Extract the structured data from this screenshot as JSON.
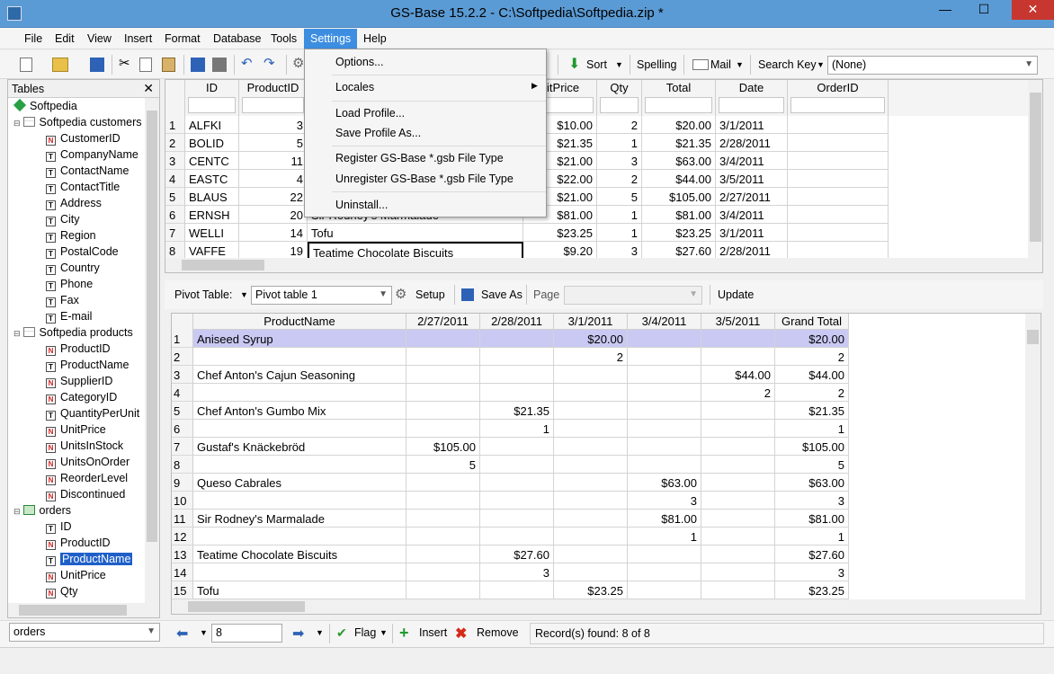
{
  "window": {
    "title": "GS-Base 15.2.2 - C:\\Softpedia\\Softpedia.zip *",
    "minimize": "—",
    "maximize": "☐",
    "close": "✕"
  },
  "menubar": [
    "File",
    "Edit",
    "View",
    "Insert",
    "Format",
    "Database",
    "Tools",
    "Settings",
    "Help"
  ],
  "toolbar": {
    "sort": "Sort",
    "spelling": "Spelling",
    "mail": "Mail",
    "search_key": "Search Key",
    "search_value": "(None)"
  },
  "settings_menu": {
    "options": "Options...",
    "locales": "Locales",
    "load_profile": "Load Profile...",
    "save_profile": "Save Profile As...",
    "register": "Register GS-Base *.gsb File Type",
    "unregister": "Unregister GS-Base *.gsb File Type",
    "uninstall": "Uninstall..."
  },
  "tables_panel": {
    "title": "Tables",
    "root": "Softpedia",
    "customers_table": "Softpedia customers",
    "customers_fields": [
      "CustomerID",
      "CompanyName",
      "ContactName",
      "ContactTitle",
      "Address",
      "City",
      "Region",
      "PostalCode",
      "Country",
      "Phone",
      "Fax",
      "E-mail"
    ],
    "products_table": "Softpedia products",
    "products_fields": [
      "ProductID",
      "ProductName",
      "SupplierID",
      "CategoryID",
      "QuantityPerUnit",
      "UnitPrice",
      "UnitsInStock",
      "UnitsOnOrder",
      "ReorderLevel",
      "Discontinued"
    ],
    "orders_table": "orders",
    "orders_fields": [
      "ID",
      "ProductID",
      "ProductName",
      "UnitPrice",
      "Qty"
    ]
  },
  "orders_grid": {
    "columns": [
      "ID",
      "ProductID",
      "nitPrice",
      "Qty",
      "Total",
      "Date",
      "OrderID"
    ],
    "rows": [
      {
        "n": "1",
        "id": "ALFKI",
        "pid": "3",
        "name": "",
        "price": "$10.00",
        "qty": "2",
        "total": "$20.00",
        "date": "3/1/2011"
      },
      {
        "n": "2",
        "id": "BOLID",
        "pid": "5",
        "name": "",
        "price": "$21.35",
        "qty": "1",
        "total": "$21.35",
        "date": "2/28/2011"
      },
      {
        "n": "3",
        "id": "CENTC",
        "pid": "11",
        "name": "",
        "price": "$21.00",
        "qty": "3",
        "total": "$63.00",
        "date": "3/4/2011"
      },
      {
        "n": "4",
        "id": "EASTC",
        "pid": "4",
        "name": "",
        "price": "$22.00",
        "qty": "2",
        "total": "$44.00",
        "date": "3/5/2011"
      },
      {
        "n": "5",
        "id": "BLAUS",
        "pid": "22",
        "name": "",
        "price": "$21.00",
        "qty": "5",
        "total": "$105.00",
        "date": "2/27/2011"
      },
      {
        "n": "6",
        "id": "ERNSH",
        "pid": "20",
        "name": "Sir Rodney's Marmalade",
        "price": "$81.00",
        "qty": "1",
        "total": "$81.00",
        "date": "3/4/2011"
      },
      {
        "n": "7",
        "id": "WELLI",
        "pid": "14",
        "name": "Tofu",
        "price": "$23.25",
        "qty": "1",
        "total": "$23.25",
        "date": "3/1/2011"
      },
      {
        "n": "8",
        "id": "VAFFE",
        "pid": "19",
        "name": "Teatime Chocolate Biscuits",
        "price": "$9.20",
        "qty": "3",
        "total": "$27.60",
        "date": "2/28/2011"
      }
    ]
  },
  "pivot_bar": {
    "label": "Pivot Table:",
    "selected": "Pivot table 1",
    "setup": "Setup",
    "save_as": "Save As",
    "page": "Page",
    "update": "Update"
  },
  "pivot_grid": {
    "columns": [
      "ProductName",
      "2/27/2011",
      "2/28/2011",
      "3/1/2011",
      "3/4/2011",
      "3/5/2011",
      "Grand Total"
    ],
    "rows": [
      [
        "1",
        "Aniseed Syrup",
        "",
        "",
        "$20.00",
        "",
        "",
        "$20.00"
      ],
      [
        "2",
        "",
        "",
        "",
        "2",
        "",
        "",
        "2"
      ],
      [
        "3",
        "Chef Anton's Cajun Seasoning",
        "",
        "",
        "",
        "",
        "$44.00",
        "$44.00"
      ],
      [
        "4",
        "",
        "",
        "",
        "",
        "",
        "2",
        "2"
      ],
      [
        "5",
        "Chef Anton's Gumbo Mix",
        "",
        "$21.35",
        "",
        "",
        "",
        "$21.35"
      ],
      [
        "6",
        "",
        "",
        "1",
        "",
        "",
        "",
        "1"
      ],
      [
        "7",
        "Gustaf's Knäckebröd",
        "$105.00",
        "",
        "",
        "",
        "",
        "$105.00"
      ],
      [
        "8",
        "",
        "5",
        "",
        "",
        "",
        "",
        "5"
      ],
      [
        "9",
        "Queso Cabrales",
        "",
        "",
        "",
        "$63.00",
        "",
        "$63.00"
      ],
      [
        "10",
        "",
        "",
        "",
        "",
        "3",
        "",
        "3"
      ],
      [
        "11",
        "Sir Rodney's Marmalade",
        "",
        "",
        "",
        "$81.00",
        "",
        "$81.00"
      ],
      [
        "12",
        "",
        "",
        "",
        "",
        "1",
        "",
        "1"
      ],
      [
        "13",
        "Teatime Chocolate Biscuits",
        "",
        "$27.60",
        "",
        "",
        "",
        "$27.60"
      ],
      [
        "14",
        "",
        "",
        "3",
        "",
        "",
        "",
        "3"
      ],
      [
        "15",
        "Tofu",
        "",
        "",
        "$23.25",
        "",
        "",
        "$23.25"
      ]
    ]
  },
  "bottom_bar": {
    "table_select": "orders",
    "record_input": "8",
    "flag": "Flag",
    "insert": "Insert",
    "remove": "Remove",
    "status": "Record(s) found: 8 of 8"
  },
  "colors": {
    "accent": "#3d8ee0",
    "titlebar": "#5b9bd5",
    "selection": "#c9c9f3",
    "close": "#c7372f"
  }
}
